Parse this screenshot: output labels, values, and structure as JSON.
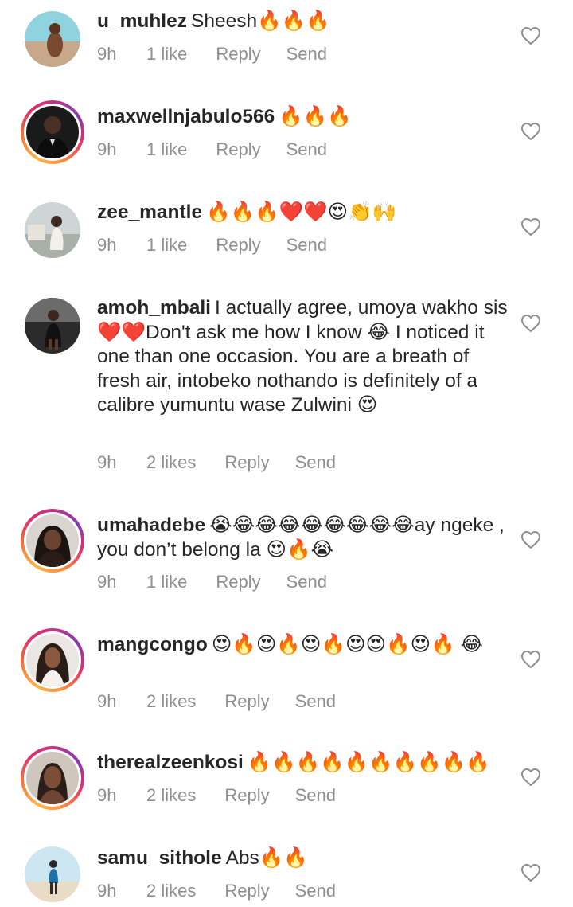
{
  "comments": [
    {
      "username": "u_muhlez",
      "text": "Sheesh🔥🔥🔥",
      "time": "9h",
      "likes": "1 like",
      "reply_label": "Reply",
      "send_label": "Send",
      "has_story": false
    },
    {
      "username": "maxwellnjabulo566",
      "text": "🔥🔥🔥",
      "time": "9h",
      "likes": "1 like",
      "reply_label": "Reply",
      "send_label": "Send",
      "has_story": true
    },
    {
      "username": "zee_mantle",
      "text": "🔥🔥🔥❤️❤️😍👏🙌",
      "time": "9h",
      "likes": "1 like",
      "reply_label": "Reply",
      "send_label": "Send",
      "has_story": false
    },
    {
      "username": "amoh_mbali",
      "text": "I actually agree, umoya wakho sis ❤️❤️Don't ask me how I know 😂 I noticed it one than one occasion. You are a breath of fresh air, intobeko nothando is definitely of a calibre yumuntu wase Zulwini 😍",
      "time": "9h",
      "likes": "2 likes",
      "reply_label": "Reply",
      "send_label": "Send",
      "has_story": false
    },
    {
      "username": "umahadebe",
      "text": "😭😂😂😂😂😂😂😂😂ay ngeke , you don’t belong la 😍🔥😭",
      "time": "9h",
      "likes": "1 like",
      "reply_label": "Reply",
      "send_label": "Send",
      "has_story": true
    },
    {
      "username": "mangcongo",
      "text": "😍🔥😍🔥😍🔥😍😍🔥😍🔥 😂",
      "time": "9h",
      "likes": "2 likes",
      "reply_label": "Reply",
      "send_label": "Send",
      "has_story": true
    },
    {
      "username": "therealzeenkosi",
      "text": "🔥🔥🔥🔥🔥🔥🔥🔥🔥🔥",
      "time": "9h",
      "likes": "2 likes",
      "reply_label": "Reply",
      "send_label": "Send",
      "has_story": true
    },
    {
      "username": "samu_sithole",
      "text": "Abs🔥🔥",
      "time": "9h",
      "likes": "2 likes",
      "reply_label": "Reply",
      "send_label": "Send",
      "has_story": false
    }
  ],
  "icons": {
    "like": "heart-outline-icon"
  },
  "colors": {
    "username": "#262626",
    "meta_text": "#8e8e8e",
    "heart_outline": "#8e8e8e",
    "story_ring_start": "#fdb64b",
    "story_ring_end": "#c13584"
  }
}
